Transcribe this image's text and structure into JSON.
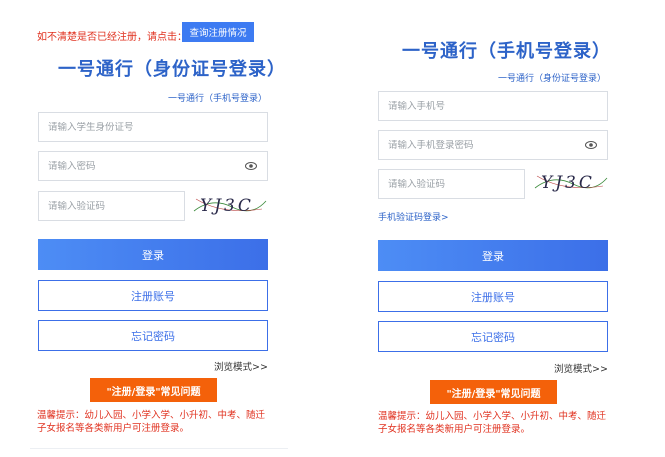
{
  "left": {
    "notice": "如不清楚是否已经注册，请点击：",
    "query_button": "查询注册情况",
    "title": "一号通行（身份证号登录）",
    "switch_link": "一号通行（手机号登录）",
    "id_placeholder": "请输入学生身份证号",
    "password_placeholder": "请输入密码",
    "captcha_placeholder": "请输入验证码",
    "captcha_text": "YJ3C",
    "login": "登录",
    "register": "注册账号",
    "forgot": "忘记密码",
    "browse": "浏览模式>>",
    "faq": "\"注册/登录\"常见问题",
    "tip_line1": "温馨提示：幼儿入园、小学入学、小升初、中考、随迁",
    "tip_line2": "子女报名等各类新用户可注册登录。"
  },
  "right": {
    "title": "一号通行（手机号登录）",
    "switch_link": "一号通行（身份证号登录）",
    "phone_placeholder": "请输入手机号",
    "password_placeholder": "请输入手机登录密码",
    "captcha_placeholder": "请输入验证码",
    "captcha_text": "YJ3C",
    "sms_login_link": "手机验证码登录>",
    "login": "登录",
    "register": "注册账号",
    "forgot": "忘记密码",
    "browse": "浏览模式>>",
    "faq": "\"注册/登录\"常见问题",
    "tip_line1": "温馨提示：幼儿入园、小学入学、小升初、中考、随迁",
    "tip_line2": "子女报名等各类新用户可注册登录。"
  },
  "colors": {
    "accent": "#3c6fe8",
    "title": "#2d63c8",
    "warning": "#e0311f",
    "faq": "#f4610a"
  },
  "icons": {
    "eye": "eye-icon"
  }
}
